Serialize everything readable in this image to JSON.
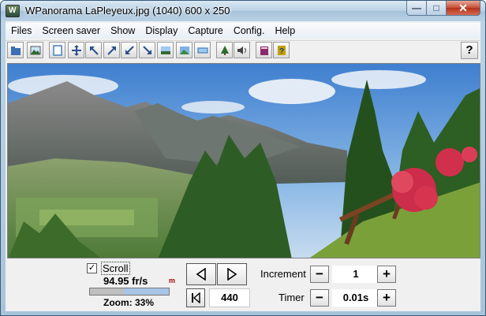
{
  "window": {
    "title": "WPanorama  LaPleyeux.jpg   (1040) 600 x 250",
    "app_icon_letter": "W",
    "min_glyph": "—",
    "max_glyph": "□",
    "close_glyph": "✕"
  },
  "menu": [
    "Files",
    "Screen saver",
    "Show",
    "Display",
    "Capture",
    "Config.",
    "Help"
  ],
  "toolbar": {
    "buttons": [
      {
        "icon": "open-file-icon",
        "color": "#3a6fb5"
      },
      {
        "icon": "picture-icon",
        "color": "#2f6b2f"
      },
      {
        "icon": "page-icon",
        "color": "#4a7fc0"
      },
      {
        "icon": "move-arrows-icon",
        "color": "#2a4f8a"
      },
      {
        "icon": "arrow-up-left-icon",
        "color": "#2a4f8a"
      },
      {
        "icon": "arrow-up-right-icon",
        "color": "#2a4f8a"
      },
      {
        "icon": "arrow-down-left-icon",
        "color": "#2a4f8a"
      },
      {
        "icon": "arrow-down-right-icon",
        "color": "#2a4f8a"
      },
      {
        "icon": "fit-height-icon",
        "color": "#356a35"
      },
      {
        "icon": "landscape-icon",
        "color": "#2e6cb0"
      },
      {
        "icon": "fit-width-icon",
        "color": "#2e6cb0"
      },
      {
        "icon": "tree-icon",
        "color": "#2f6b2f"
      },
      {
        "icon": "speaker-icon",
        "color": "#444444"
      },
      {
        "icon": "book-icon",
        "color": "#8b2a6a"
      },
      {
        "icon": "help-book-icon",
        "color": "#c0a000"
      }
    ],
    "help_label": "?"
  },
  "controls": {
    "scroll_label": "Scroll",
    "scroll_checked": true,
    "checkmark": "✓",
    "fps": "94.95 fr/s",
    "fps_indicator": "m",
    "zoom_label": "Zoom: 33%",
    "zoom_fraction": 0.57,
    "position": "440",
    "increment_label": "Increment",
    "increment_value": "1",
    "timer_label": "Timer",
    "timer_value": "0.01s",
    "minus": "−",
    "plus": "+"
  }
}
